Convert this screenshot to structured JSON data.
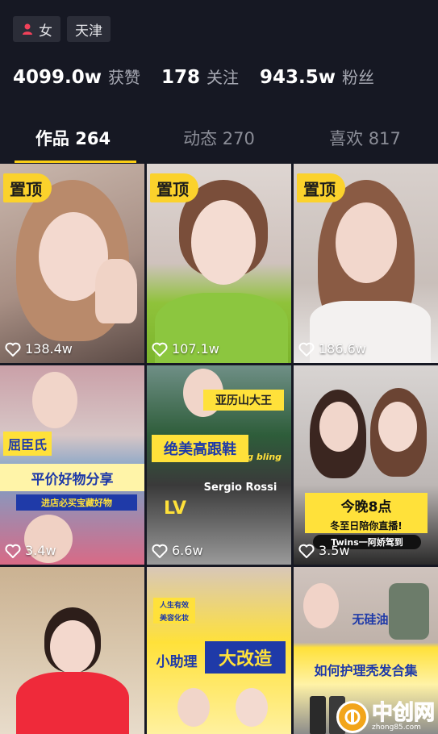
{
  "profile": {
    "gender_tag": "女",
    "location_tag": "天津",
    "stats": [
      {
        "num": "4099.0w",
        "label": "获赞"
      },
      {
        "num": "178",
        "label": "关注"
      },
      {
        "num": "943.5w",
        "label": "粉丝"
      }
    ]
  },
  "tabs": [
    {
      "label": "作品 264",
      "active": true
    },
    {
      "label": "动态 270",
      "active": false
    },
    {
      "label": "喜欢 817",
      "active": false
    }
  ],
  "pin_label": "置顶",
  "videos": [
    {
      "likes": "138.4w",
      "pinned": true
    },
    {
      "likes": "107.1w",
      "pinned": true
    },
    {
      "likes": "186.6w",
      "pinned": true
    },
    {
      "likes": "3.4w",
      "pinned": false,
      "overlay": [
        "屈臣氏",
        "平价好物分享",
        "进店必买宝藏好物"
      ]
    },
    {
      "likes": "6.6w",
      "pinned": false,
      "overlay": [
        "亚历山大王",
        "绝美高跟鞋",
        "bling bling",
        "Sergio Rossi",
        "LV"
      ]
    },
    {
      "likes": "3.5w",
      "pinned": false,
      "overlay": [
        "今晚8点",
        "冬至日陪你直播!",
        "Twins一阿娇驾到"
      ]
    },
    {
      "likes": "",
      "pinned": false
    },
    {
      "likes": "",
      "pinned": false,
      "overlay": [
        "人生有效",
        "美容化妆",
        "小助理",
        "大改造"
      ]
    },
    {
      "likes": "",
      "pinned": false,
      "overlay": [
        "无硅油",
        "如何护理秃发合集"
      ]
    }
  ],
  "watermark": {
    "text": "中创网",
    "sub": "zhong85.com"
  },
  "colors": {
    "background": "#161823",
    "accent": "#face15",
    "pin": "#fbd22c"
  }
}
